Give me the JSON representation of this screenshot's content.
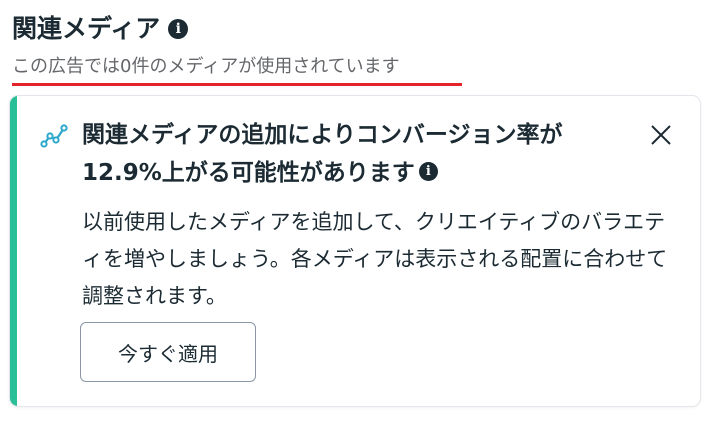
{
  "section": {
    "title": "関連メディア",
    "subtitle": "この広告では0件のメディアが使用されています"
  },
  "card": {
    "title": "関連メディアの追加によりコンバージョン率が12.9%上がる可能性があります",
    "body": "以前使用したメディアを追加して、クリエイティブのバラエティを増やしましょう。各メディアは表示される配置に合わせて調整されます。",
    "apply_label": "今すぐ適用",
    "icons": {
      "trend": "trend-line-icon",
      "close": "close-icon",
      "info": "info-icon"
    }
  },
  "colors": {
    "accent": "#2bbf98",
    "underline": "#e3242b",
    "text": "#1c2b33",
    "subtext": "#65676b"
  }
}
